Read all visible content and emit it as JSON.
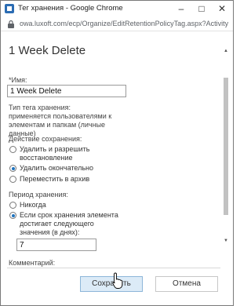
{
  "window": {
    "title": "Тег хранения - Google Chrome",
    "url": "owa.luxoft.com/ecp/Organize/EditRetentionPolicyTag.aspx?ActivityCorrelat..."
  },
  "form": {
    "page_title": "1 Week Delete",
    "name_label": "*Имя:",
    "name_value": "1 Week Delete",
    "tag_type_label": "Тип тега хранения:",
    "tag_type_value": "применяется пользователями к элементам и папкам (личные данные)",
    "retention_action_label": "Действие сохранения:",
    "retention_actions": [
      {
        "label": "Удалить и разрешить восстановление",
        "checked": false
      },
      {
        "label": "Удалить окончательно",
        "checked": true
      },
      {
        "label": "Переместить в архив",
        "checked": false
      }
    ],
    "retention_period_label": "Период хранения:",
    "retention_periods": [
      {
        "label": "Никогда",
        "checked": false
      },
      {
        "label": "Если срок хранения элемента достигает следующего значения (в днях):",
        "checked": true
      }
    ],
    "days_value": "7",
    "comment_label": "Комментарий:"
  },
  "buttons": {
    "save": "Сохранить",
    "cancel": "Отмена"
  }
}
